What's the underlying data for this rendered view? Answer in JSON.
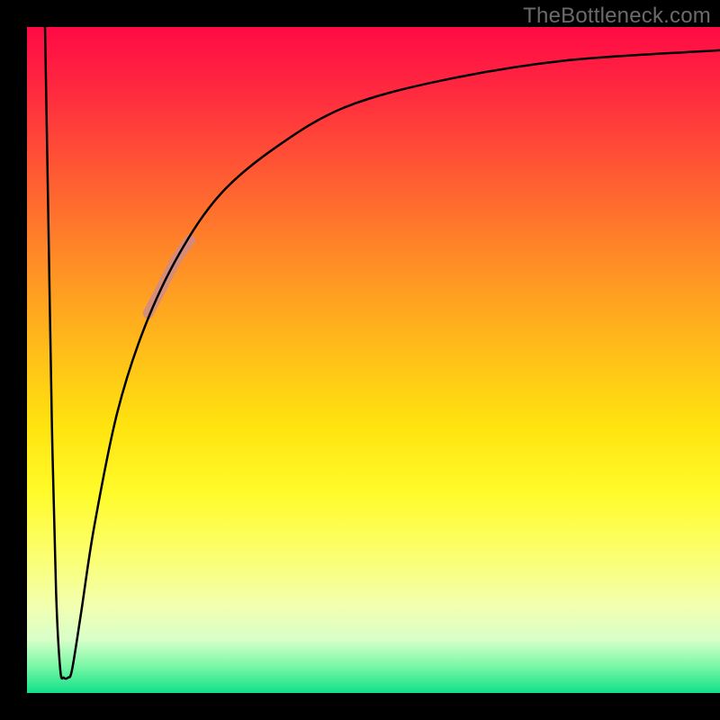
{
  "watermark": "TheBottleneck.com",
  "chart_data": {
    "type": "line",
    "title": "",
    "xlabel": "",
    "ylabel": "",
    "x_range": [
      0,
      100
    ],
    "y_range": [
      0,
      100
    ],
    "gradient_stops": [
      {
        "offset": 0,
        "color": "#ff0a45"
      },
      {
        "offset": 10,
        "color": "#ff2b3f"
      },
      {
        "offset": 22,
        "color": "#ff5a33"
      },
      {
        "offset": 35,
        "color": "#ff8c26"
      },
      {
        "offset": 48,
        "color": "#ffbb1a"
      },
      {
        "offset": 60,
        "color": "#ffe40f"
      },
      {
        "offset": 70,
        "color": "#fffb2a"
      },
      {
        "offset": 80,
        "color": "#fbff75"
      },
      {
        "offset": 87,
        "color": "#f2ffb0"
      },
      {
        "offset": 92,
        "color": "#d8ffc9"
      },
      {
        "offset": 96,
        "color": "#79f7a6"
      },
      {
        "offset": 100,
        "color": "#11e08a"
      }
    ],
    "series": [
      {
        "name": "bottleneck-curve",
        "color": "#000000",
        "stroke_width": 2.5,
        "points": [
          {
            "x": 2.6,
            "y": 100
          },
          {
            "x": 3.1,
            "y": 70
          },
          {
            "x": 3.6,
            "y": 40
          },
          {
            "x": 4.2,
            "y": 15
          },
          {
            "x": 4.8,
            "y": 3.5
          },
          {
            "x": 5.3,
            "y": 2.3
          },
          {
            "x": 5.9,
            "y": 2.3
          },
          {
            "x": 6.5,
            "y": 3.5
          },
          {
            "x": 7.8,
            "y": 12
          },
          {
            "x": 9.7,
            "y": 25
          },
          {
            "x": 13.0,
            "y": 42
          },
          {
            "x": 17.0,
            "y": 55
          },
          {
            "x": 22.0,
            "y": 66
          },
          {
            "x": 28.0,
            "y": 75
          },
          {
            "x": 36.0,
            "y": 82
          },
          {
            "x": 46.0,
            "y": 88
          },
          {
            "x": 60.0,
            "y": 92
          },
          {
            "x": 78.0,
            "y": 95
          },
          {
            "x": 100.0,
            "y": 96.5
          }
        ]
      },
      {
        "name": "highlight-segment",
        "color": "#cf8b8b",
        "stroke_width": 12,
        "opacity": 0.85,
        "points": [
          {
            "x": 17.5,
            "y": 57
          },
          {
            "x": 19.5,
            "y": 61
          },
          {
            "x": 21.5,
            "y": 65
          },
          {
            "x": 23.5,
            "y": 68
          }
        ]
      }
    ]
  }
}
